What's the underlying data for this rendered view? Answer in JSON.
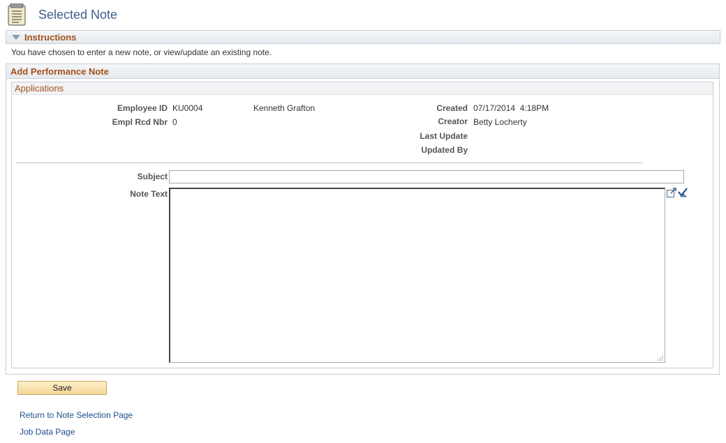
{
  "page": {
    "title": "Selected Note"
  },
  "instructions": {
    "header": "Instructions",
    "text": "You have chosen to enter a new note, or view/update an existing note."
  },
  "performance_note": {
    "header": "Add Performance Note",
    "applications": {
      "header": "Applications",
      "fields": {
        "employee_id_label": "Employee ID",
        "employee_id": "KU0004",
        "employee_name": "Kenneth Grafton",
        "empl_rcd_label": "Empl Rcd Nbr",
        "empl_rcd": "0",
        "created_label": "Created",
        "created": "07/17/2014  4:18PM",
        "creator_label": "Creator",
        "creator": "Betty Locherty",
        "last_update_label": "Last Update",
        "last_update": "",
        "updated_by_label": "Updated By",
        "updated_by": ""
      },
      "subject_label": "Subject",
      "subject_value": "",
      "note_text_label": "Note Text",
      "note_text_value": ""
    }
  },
  "actions": {
    "save_label": "Save",
    "return_link": "Return to Note Selection Page",
    "job_data_link": "Job Data Page"
  },
  "icons": {
    "page": "notepad-icon",
    "collapse": "triangle-down-icon",
    "expand_editor": "expand-editor-icon",
    "spell_check": "spell-check-icon"
  }
}
